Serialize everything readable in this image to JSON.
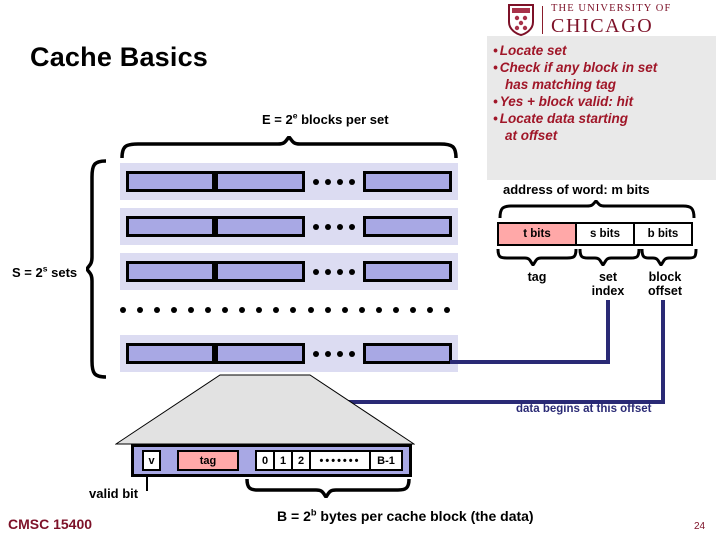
{
  "logo": {
    "line1": "THE UNIVERSITY OF",
    "line2": "CHICAGO",
    "crest_icon": "shield-crest-icon"
  },
  "title": "Cache Basics",
  "bullets": [
    {
      "text": "Locate set",
      "continuation": false
    },
    {
      "text": "Check if any block in set",
      "continuation": false
    },
    {
      "text": "has matching tag",
      "continuation": true
    },
    {
      "text": "Yes + block valid: hit",
      "continuation": false
    },
    {
      "text": "Locate data starting",
      "continuation": false
    },
    {
      "text": "at offset",
      "continuation": true
    }
  ],
  "bullet_marker": "•",
  "cache": {
    "e_label_prefix": "E = 2",
    "e_label_sup": "e",
    "e_label_suffix": " blocks per set",
    "s_label_prefix": "S = 2",
    "s_label_sup": "s",
    "s_label_suffix": " sets",
    "rows": 4,
    "blocks_per_row": 3
  },
  "address": {
    "caption": "address of word: m bits",
    "fields": [
      {
        "label": "t bits",
        "name": "tag",
        "name_line2": ""
      },
      {
        "label": "s bits",
        "name": "set",
        "name_line2": "index"
      },
      {
        "label": "b bits",
        "name": "block",
        "name_line2": "offset"
      }
    ]
  },
  "offset_caption": "data begins at this offset",
  "block_detail": {
    "valid": "v",
    "tag": "tag",
    "bytes": [
      "0",
      "1",
      "2"
    ],
    "gap": "•••••••",
    "last_byte": "B-1",
    "valid_bit_label": "valid bit",
    "b_caption_prefix": "B = 2",
    "b_caption_sup": "b",
    "b_caption_suffix": " bytes per cache block (the data)"
  },
  "footer": {
    "course": "CMSC 15400",
    "page": "24"
  },
  "colors": {
    "accent_red": "#7d1128",
    "bullet_red": "#a01628",
    "block_fill": "#a8a8e4",
    "row_band": "#dcdcf2",
    "tag_pink": "#ffa8a8",
    "navy": "#2a2a75",
    "panel_gray": "#e9e9e9"
  }
}
